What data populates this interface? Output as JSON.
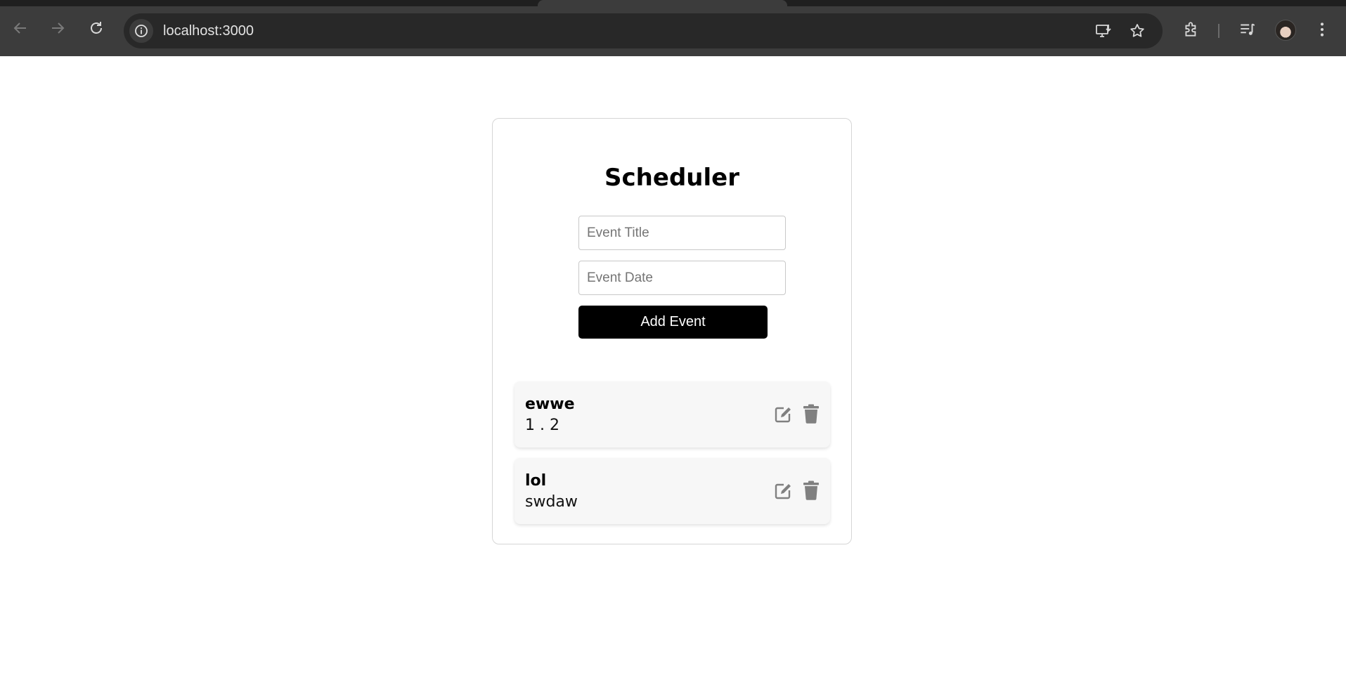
{
  "browser": {
    "url": "localhost:3000",
    "icons": {
      "back": "arrow-left-icon",
      "forward": "arrow-right-icon",
      "reload": "reload-icon",
      "site_info": "info-icon",
      "install": "install-app-icon",
      "bookmark": "star-icon",
      "extensions": "puzzle-icon",
      "media": "media-playlist-icon",
      "menu": "kebab-menu-icon"
    }
  },
  "app": {
    "title": "Scheduler",
    "form": {
      "title_placeholder": "Event Title",
      "title_value": "",
      "date_placeholder": "Event Date",
      "date_value": "",
      "add_label": "Add Event"
    },
    "events": [
      {
        "title": "ewwe",
        "date": "1 . 2"
      },
      {
        "title": "lol",
        "date": "swdaw"
      }
    ]
  },
  "colors": {
    "button_bg": "#000000",
    "button_text": "#ffffff",
    "icon_gray": "#808080",
    "event_bg": "#f7f7f7"
  }
}
